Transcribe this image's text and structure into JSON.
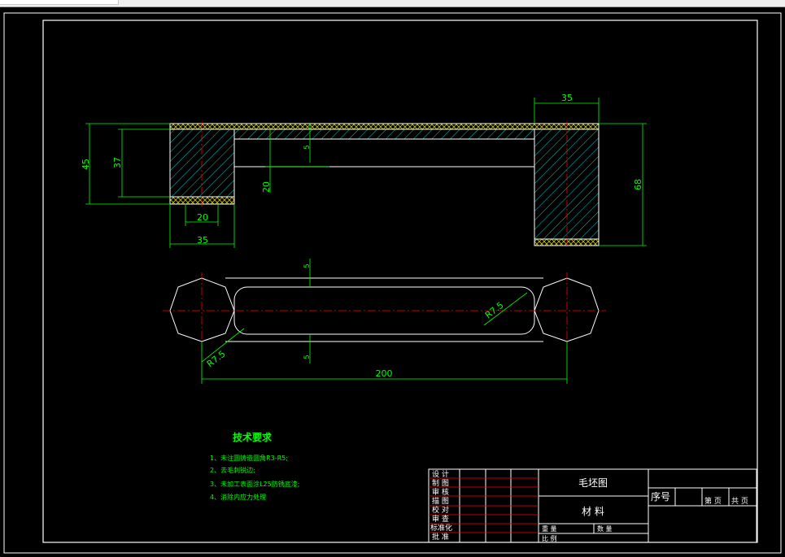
{
  "drawing": {
    "dimensions": {
      "top_width": "35",
      "left_height_outer": "45",
      "left_height_inner": "37",
      "wall_thickness": "5",
      "gap_height": "20",
      "left_bottom_inner": "20",
      "left_bottom_outer": "35",
      "right_height": "68",
      "plan_top_thickness": "5",
      "plan_bottom_thickness": "5",
      "radius_right": "R7.5",
      "radius_left": "R7.5",
      "total_length": "200"
    },
    "tech_requirements": {
      "title": "技术要求",
      "items": [
        "1、未注圆铸造圆角R3-R5;",
        "2、去毛刺锐边;",
        "3、未加工表面涂L25防锈底漆;",
        "4、消除内应力处理"
      ]
    },
    "title_block": {
      "drawing_name": "毛坯图",
      "material_label": "材 料",
      "serial_label": "序号",
      "sheet_label": "第 页",
      "total_label": "共 页",
      "weight_label": "重 量",
      "scale_label": "比 例",
      "count_label": "数 量",
      "rows": [
        "设 计",
        "制 图",
        "审 核",
        "描 图",
        "校 对",
        "审 查",
        "标准化",
        "批 准"
      ]
    }
  },
  "colors": {
    "background": "#000000",
    "lines": "#ffffff",
    "dimensions": "#00ff00",
    "centerlines": "#ff0000",
    "hatch": "#00c8c8",
    "hatch_alt": "#c8c800",
    "frame": "#ffffff"
  }
}
